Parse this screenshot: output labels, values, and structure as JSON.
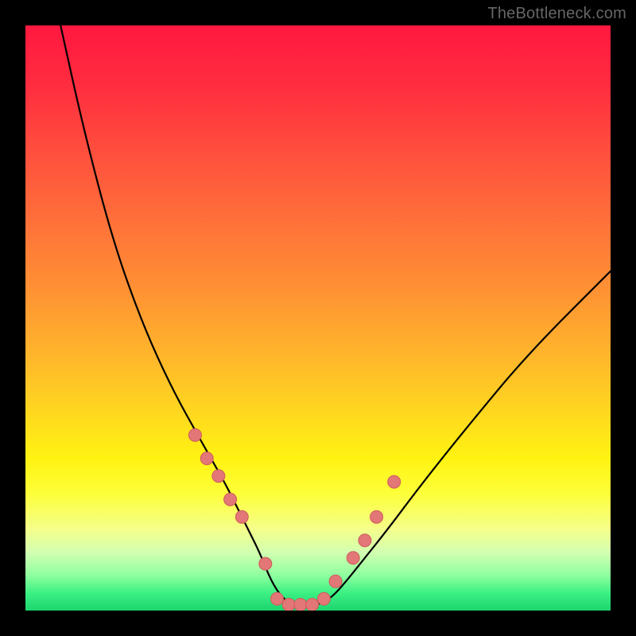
{
  "watermark": "TheBottleneck.com",
  "chart_data": {
    "type": "line",
    "title": "",
    "xlabel": "",
    "ylabel": "",
    "xlim": [
      0,
      100
    ],
    "ylim": [
      0,
      100
    ],
    "grid": false,
    "legend": false,
    "background_gradient": {
      "top": "#ff183f",
      "mid": "#ffd71f",
      "bottom": "#1cd46e"
    },
    "series": [
      {
        "name": "bottleneck-curve",
        "color": "#000000",
        "x": [
          6,
          10,
          15,
          20,
          25,
          30,
          34,
          36,
          38,
          40,
          42,
          44,
          46,
          48,
          50,
          52,
          54,
          58,
          62,
          68,
          76,
          86,
          100
        ],
        "values": [
          100,
          82,
          63,
          49,
          38,
          29,
          22,
          18,
          14,
          10,
          5,
          2,
          1,
          1,
          1,
          2,
          4,
          9,
          14,
          22,
          32,
          44,
          58
        ]
      }
    ],
    "markers": [
      {
        "name": "left-arm",
        "x": [
          29,
          31,
          33,
          35,
          37,
          41
        ],
        "y": [
          30,
          26,
          23,
          19,
          16,
          8
        ]
      },
      {
        "name": "trough",
        "x": [
          43,
          45,
          47,
          49,
          51
        ],
        "y": [
          2,
          1,
          1,
          1,
          2
        ]
      },
      {
        "name": "right-arm",
        "x": [
          53,
          56,
          58,
          60,
          63
        ],
        "y": [
          5,
          9,
          12,
          16,
          22
        ]
      }
    ],
    "marker_style": {
      "fill": "#e37676",
      "stroke": "#ce5c5c",
      "radius_px": 8
    }
  }
}
